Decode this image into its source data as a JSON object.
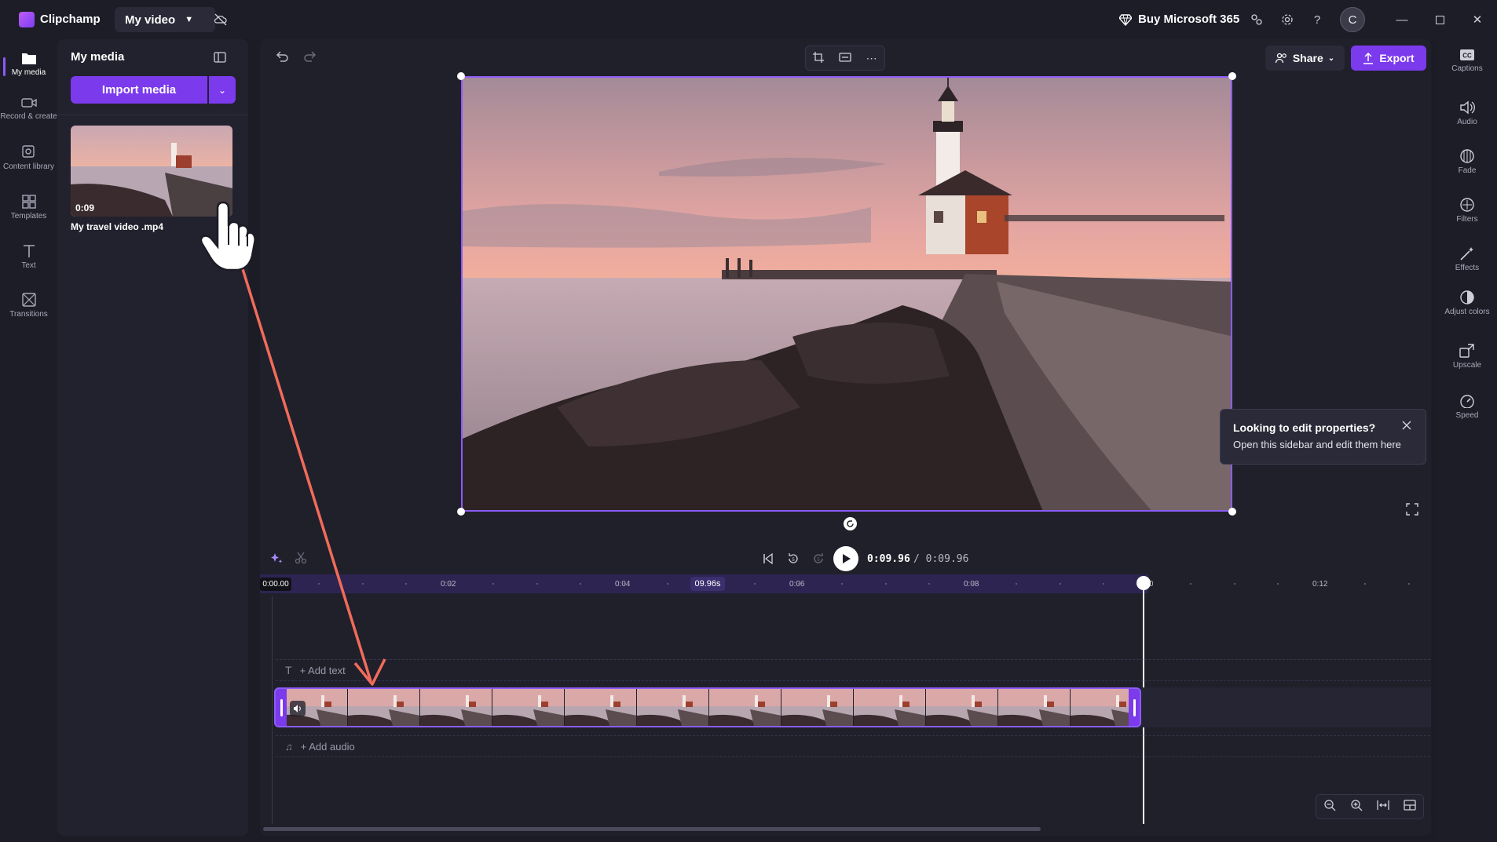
{
  "titlebar": {
    "app_name": "Clipchamp",
    "project_name": "My video",
    "buy_label": "Buy Microsoft 365",
    "avatar_initial": "C"
  },
  "left_rail": [
    {
      "label": "My media",
      "icon": "folder-icon"
    },
    {
      "label": "Record & create",
      "icon": "camera-icon"
    },
    {
      "label": "Content library",
      "icon": "library-icon"
    },
    {
      "label": "Templates",
      "icon": "templates-icon"
    },
    {
      "label": "Text",
      "icon": "text-icon"
    },
    {
      "label": "Transitions",
      "icon": "transitions-icon"
    }
  ],
  "media_panel": {
    "title": "My media",
    "import_label": "Import media",
    "items": [
      {
        "name": "My travel video .mp4",
        "duration": "0:09"
      }
    ]
  },
  "preview": {
    "tooltip_title": "Looking to edit properties?",
    "tooltip_body": "Open this sidebar and edit them here"
  },
  "actions": {
    "share_label": "Share",
    "export_label": "Export"
  },
  "right_rail": [
    {
      "label": "Captions",
      "icon": "captions-icon"
    },
    {
      "label": "Audio",
      "icon": "speaker-icon"
    },
    {
      "label": "Fade",
      "icon": "fade-icon"
    },
    {
      "label": "Filters",
      "icon": "filters-icon"
    },
    {
      "label": "Effects",
      "icon": "magic-wand-icon"
    },
    {
      "label": "Adjust colors",
      "icon": "contrast-icon"
    },
    {
      "label": "Upscale",
      "icon": "upscale-icon"
    },
    {
      "label": "Speed",
      "icon": "speedometer-icon"
    }
  ],
  "playback": {
    "current": "0:09.96",
    "total": "/ 0:09.96"
  },
  "timeline": {
    "ruler_start": "0:00.00",
    "ruler_hover": "09.96s",
    "ticks": [
      "0:02",
      "0:04",
      "0:06",
      "0:08",
      "0:10",
      "0:12"
    ],
    "add_text_label": "+ Add text",
    "add_audio_label": "+ Add audio"
  },
  "colors": {
    "accent": "#7c3aed",
    "selection": "#8b5cf6",
    "annotation_arrow": "#f26b5b"
  }
}
